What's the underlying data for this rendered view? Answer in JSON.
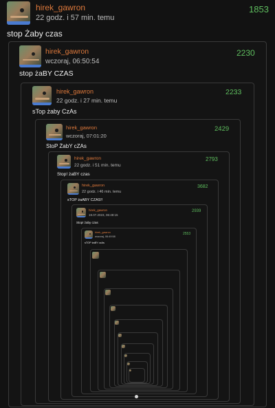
{
  "posts": [
    {
      "user": "hirek_gawron",
      "time": "22 godz. i 57 min. temu",
      "score": "1853",
      "text": "stop Żaby czas"
    },
    {
      "user": "hirek_gawron",
      "time": "wczoraj, 06:50:54",
      "score": "2230",
      "text": "stop żaBY CZAS"
    },
    {
      "user": "hirek_gawron",
      "time": "22 godz. i 27 min. temu",
      "score": "2233",
      "text": "sTop żaby CzAs"
    },
    {
      "user": "hirek_gawron",
      "time": "wczoraj, 07:01:20",
      "score": "2429",
      "text": "StoP ŻabY cZAs"
    },
    {
      "user": "hirek_gawron",
      "time": "22 godz. i 51 min. temu",
      "score": "2793",
      "text": "Stop! żaBY czas"
    },
    {
      "user": "hirek_gawron",
      "time": "22 godz. i 46 min. temu",
      "score": "3682",
      "text": "sTOP żaABY CZAS!!"
    },
    {
      "user": "hirek_gawron",
      "time": "19.07.2023, 06:48:15",
      "score": "2939",
      "text": "Stop! żaby czas"
    },
    {
      "user": "hirek_gawron",
      "time": "wczoraj, 06:49:58",
      "score": "2553",
      "text": "sTOP żaBY czAs"
    }
  ]
}
